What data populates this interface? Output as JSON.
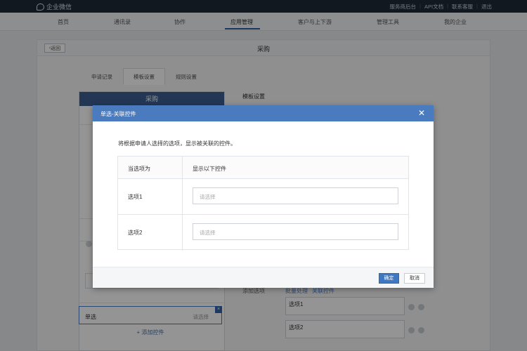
{
  "topbar": {
    "logo_text": "企业微信",
    "links": [
      "服务商后台",
      "API文档",
      "联系客服",
      "退出"
    ]
  },
  "nav": {
    "items": [
      "首页",
      "通讯录",
      "协作",
      "应用管理",
      "客户与上下游",
      "管理工具",
      "我的企业"
    ],
    "active": "应用管理"
  },
  "page": {
    "back_label": "返回",
    "title": "采购",
    "tabs": [
      "申请记录",
      "模板设置",
      "规则设置"
    ],
    "active_tab": "模板设置"
  },
  "preview": {
    "header": "采购",
    "selected_field_label": "单选",
    "selected_field_placeholder": "请选择",
    "add_control_label": "+ 添加控件"
  },
  "settings": {
    "title": "模板设置",
    "add_option_label": "添加选项",
    "links": [
      "批量处理",
      "关联控件"
    ],
    "options": [
      "选项1",
      "选项2"
    ]
  },
  "modal": {
    "title": "单选-关联控件",
    "description": "将根据申请人选择的选项，显示被关联的控件。",
    "col_when": "当选项为",
    "col_show": "显示以下控件",
    "rows": [
      {
        "option": "选项1",
        "placeholder": "请选择"
      },
      {
        "option": "选项2",
        "placeholder": "请选择"
      }
    ],
    "ok_label": "确定",
    "cancel_label": "取消"
  },
  "colors": {
    "topbar": "#1e2a38",
    "modal_header": "#4a7bbf",
    "primary_button": "#3f77c0"
  }
}
